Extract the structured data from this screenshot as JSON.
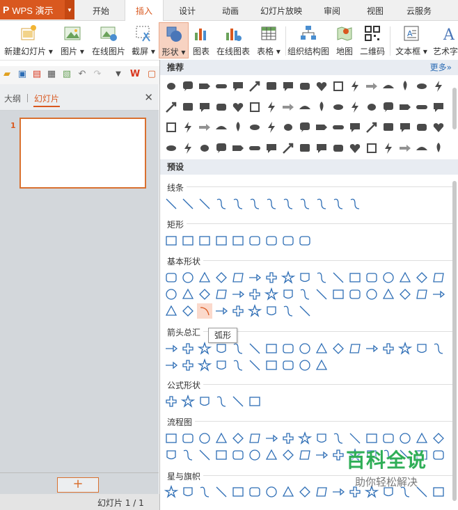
{
  "app": {
    "name": "WPS 演示",
    "logo_glyph": "P"
  },
  "tabs": [
    {
      "label": "开始"
    },
    {
      "label": "插入"
    },
    {
      "label": "设计"
    },
    {
      "label": "动画"
    },
    {
      "label": "幻灯片放映"
    },
    {
      "label": "审阅"
    },
    {
      "label": "视图"
    },
    {
      "label": "云服务"
    }
  ],
  "active_tab": "插入",
  "ribbon": {
    "items": [
      {
        "label": "新建幻灯片 ▾"
      },
      {
        "label": "图片 ▾"
      },
      {
        "label": "在线图片"
      },
      {
        "label": "截屏 ▾"
      },
      {
        "label": "形状 ▾"
      },
      {
        "label": "图表"
      },
      {
        "label": "在线图表"
      },
      {
        "label": "表格 ▾"
      },
      {
        "label": "组织结构图"
      },
      {
        "label": "地图"
      },
      {
        "label": "二维码"
      },
      {
        "label": "文本框 ▾"
      },
      {
        "label": "艺术字"
      }
    ]
  },
  "left_panel": {
    "tab_outline": "大纲",
    "tab_slides": "幻灯片",
    "close_glyph": "✕",
    "slide_number": "1",
    "add_glyph": "+"
  },
  "status": {
    "slide_counter": "幻灯片 1 / 1"
  },
  "dropdown": {
    "recommended_title": "推荐",
    "more_label": "更多»",
    "preset_title": "预设",
    "groups": {
      "lines": "线条",
      "rectangles": "矩形",
      "basic": "基本形状",
      "arrows": "箭头总汇",
      "equation": "公式形状",
      "flowchart": "流程图",
      "stars": "星与旗帜"
    },
    "tooltip": "弧形"
  },
  "watermark": {
    "title": "百科全说",
    "subtitle": "助你轻松解决"
  },
  "colors": {
    "accent": "#d9581f",
    "shape_stroke": "#2d6db5",
    "recommended_fill": "#4a4a4a"
  }
}
